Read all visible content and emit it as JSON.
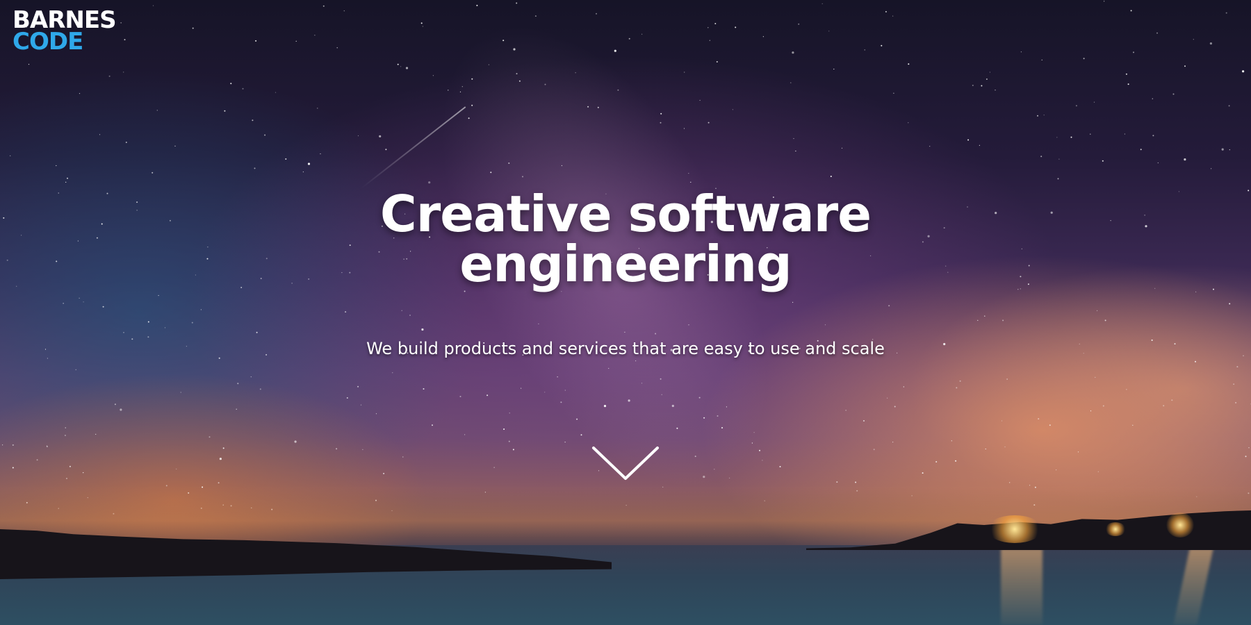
{
  "brand": {
    "line1": "BARNES",
    "line2": "CODE",
    "line1_color": "#ffffff",
    "line2_color": "#2fa8e9"
  },
  "hero": {
    "title_line1": "Creative software",
    "title_line2": "engineering",
    "subtitle": "We build products and services that are easy to use and scale",
    "scroll_icon": "chevron-down-icon"
  }
}
